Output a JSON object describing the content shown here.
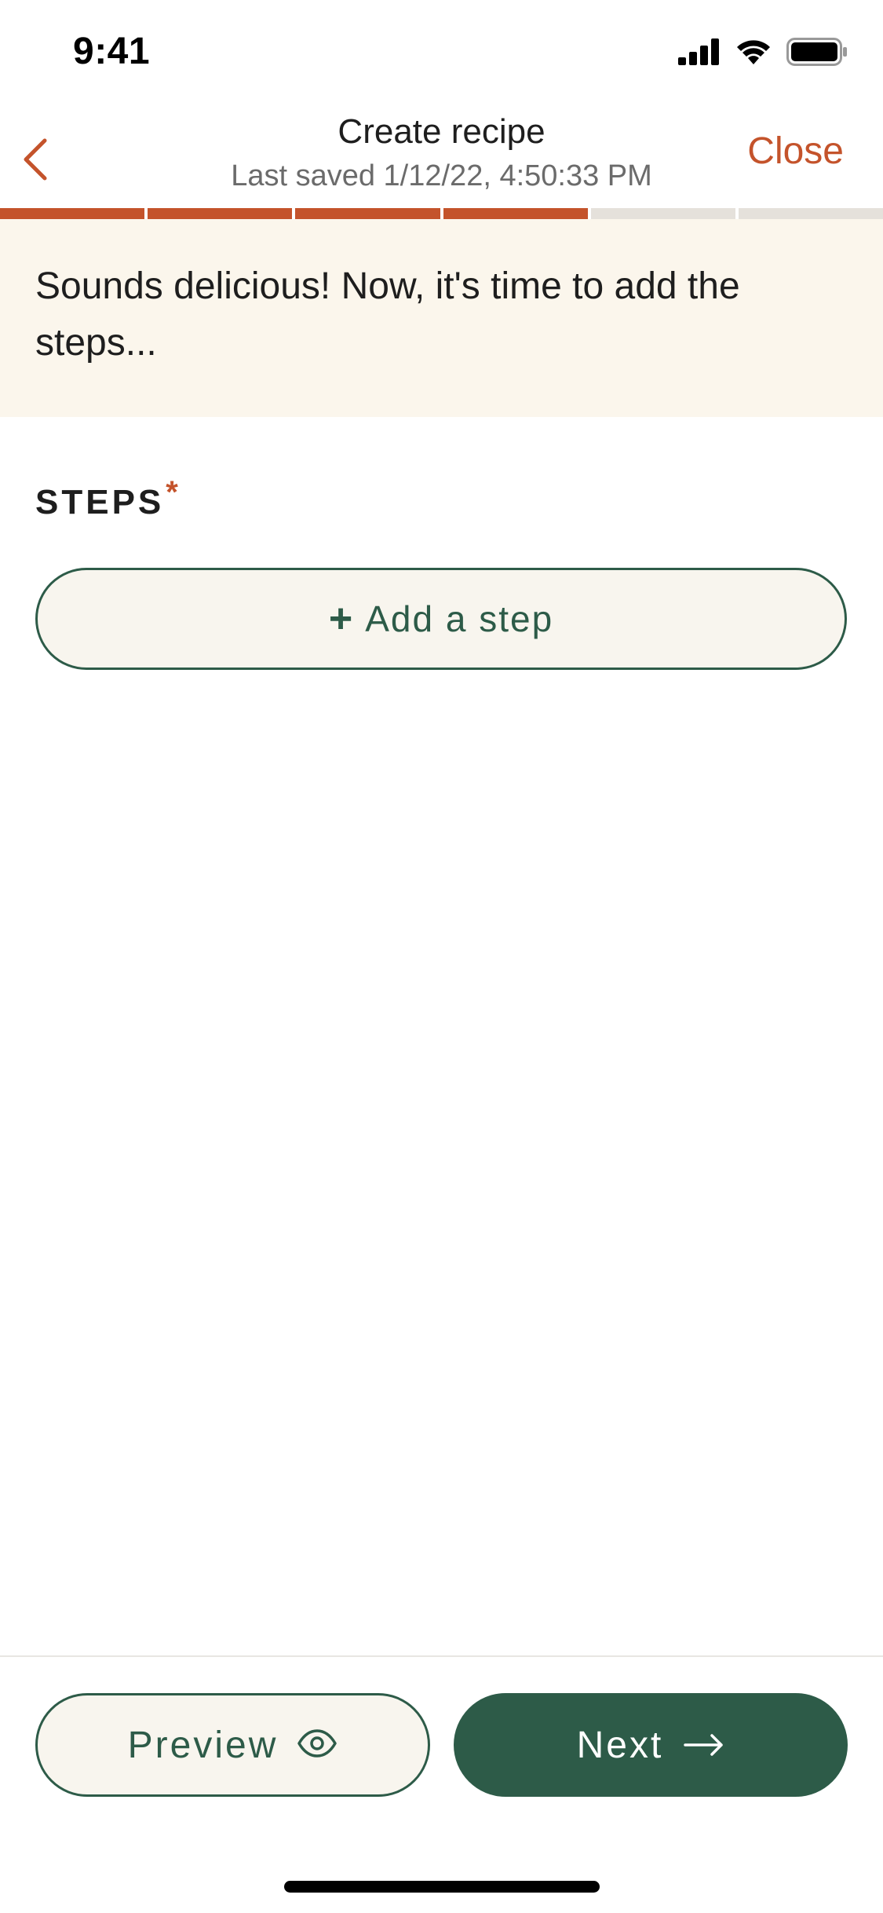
{
  "status_bar": {
    "time": "9:41",
    "icons": [
      "cellular-signal-icon",
      "wifi-icon",
      "battery-icon"
    ]
  },
  "header": {
    "title": "Create recipe",
    "subtitle": "Last saved 1/12/22, 4:50:33 PM",
    "close_label": "Close",
    "back_icon": "chevron-left-icon"
  },
  "progress": {
    "total_steps": 6,
    "completed_steps": 4
  },
  "banner": {
    "text": "Sounds delicious! Now, it's time to add the steps..."
  },
  "steps_section": {
    "label": "STEPS",
    "required_marker": "*",
    "add_button": {
      "icon_text": "+",
      "label": "Add a step"
    }
  },
  "footer": {
    "preview_label": "Preview",
    "preview_icon": "eye-icon",
    "next_label": "Next",
    "next_icon": "arrow-right-icon"
  },
  "colors": {
    "accent": "#c4532b",
    "primary": "#2d5b48",
    "banner_bg": "#fbf6ec",
    "button_bg_light": "#f8f5ee",
    "progress_inactive": "#e5e1db"
  }
}
